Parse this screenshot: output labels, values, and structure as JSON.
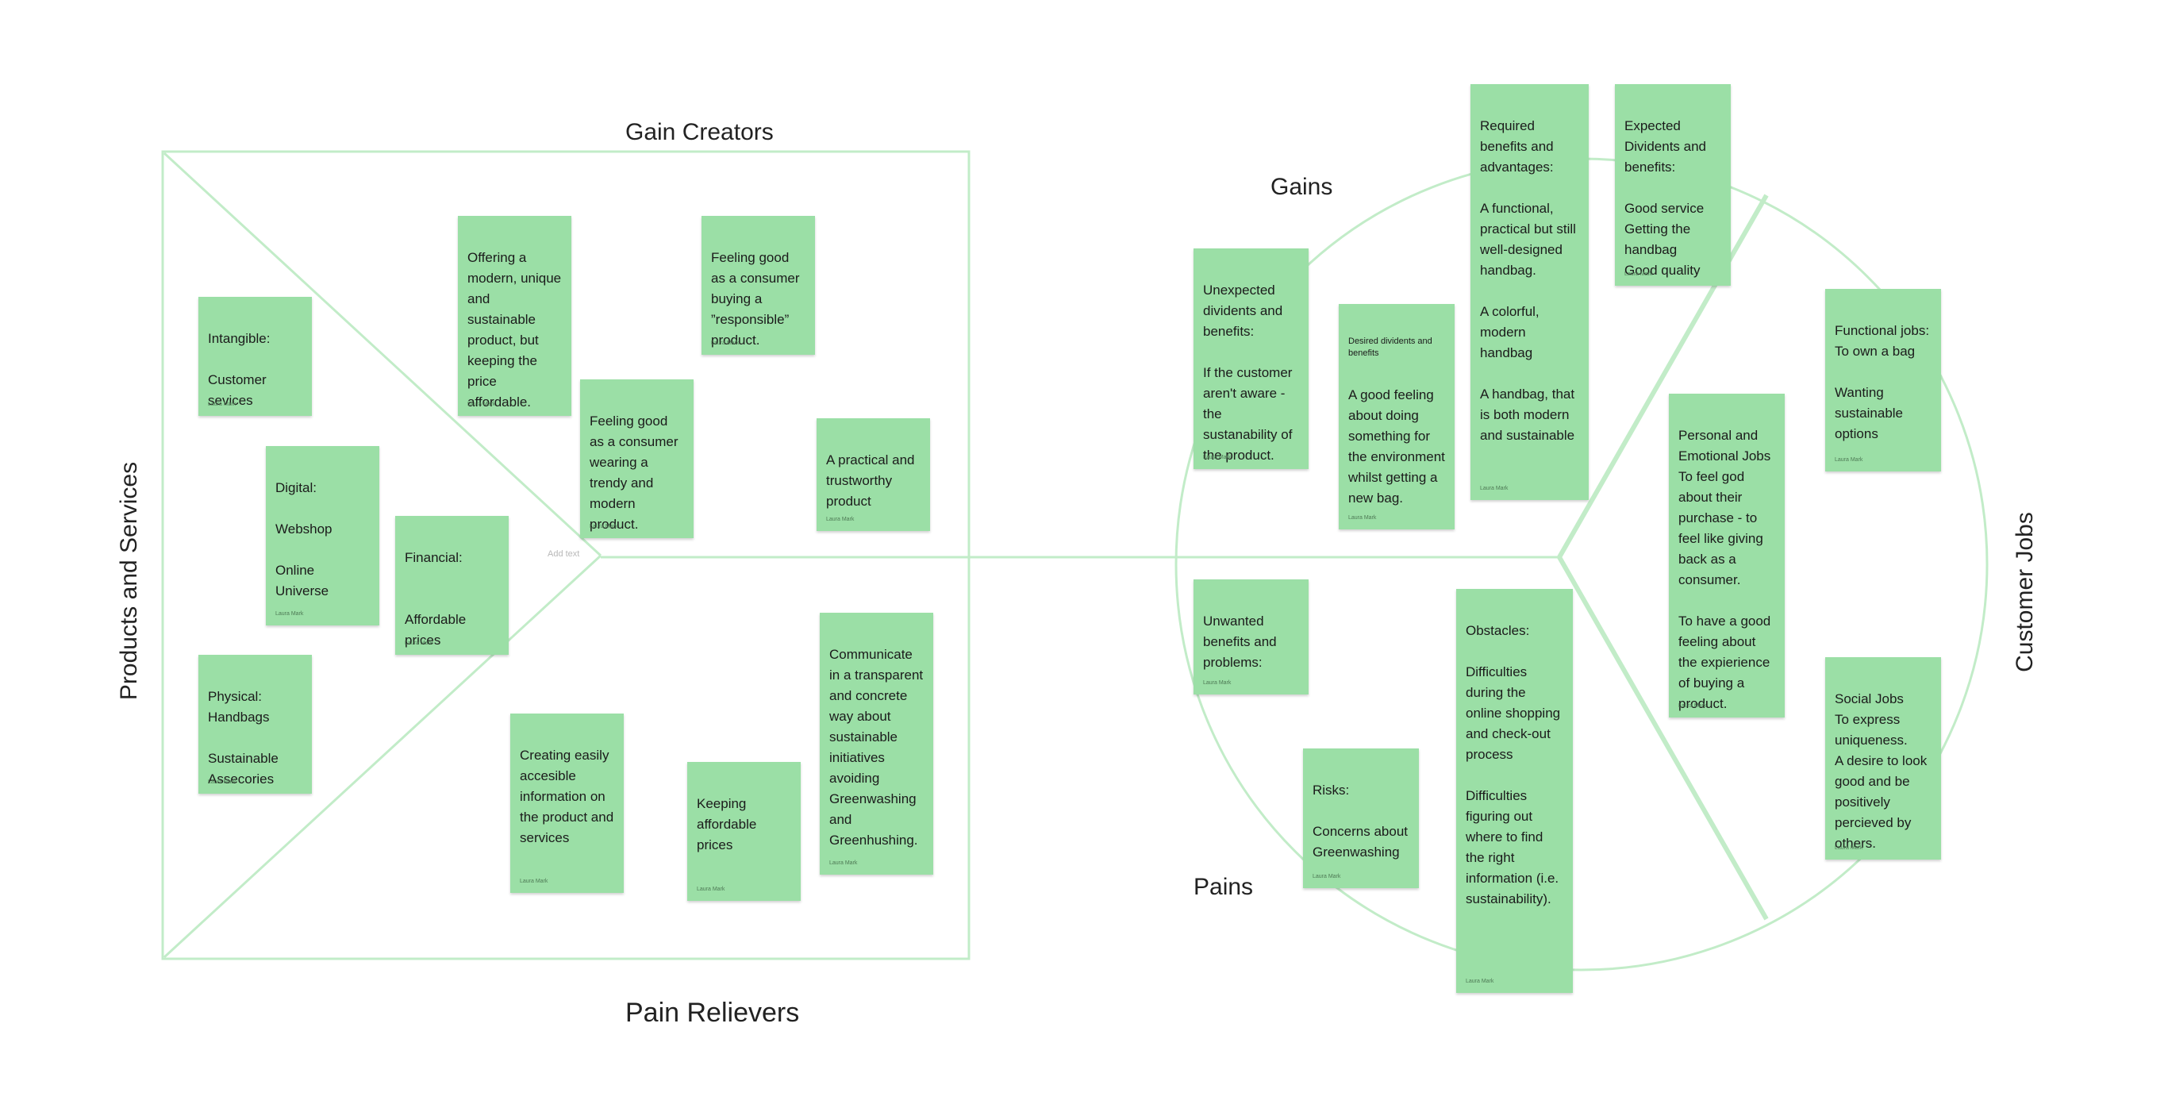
{
  "labels": {
    "gain_creators": "Gain Creators",
    "pain_relievers": "Pain Relievers",
    "products_services": "Products and Services",
    "gains": "Gains",
    "pains": "Pains",
    "customer_jobs": "Customer Jobs",
    "add_text": "Add text"
  },
  "colors": {
    "sticky_note": "#9bdfa6",
    "frame_line": "#c2ecc8"
  },
  "author": "Laura Mark",
  "notes": {
    "intangible": "Intangible:\n\nCustomer sevices",
    "digital": "Digital:\n\nWebshop\n\nOnline Universe",
    "financial": "Financial:\n\n\nAffordable prices",
    "physical": "Physical:\nHandbags\n\nSustainable Assecories",
    "offering": "Offering a modern, unique and sustainable product, but keeping the price affordable.",
    "feeling_wearing": "Feeling good as a consumer wearing a trendy and modern product.",
    "feeling_buying": "Feeling good as a consumer buying a ”responsible” product.",
    "practical": "A practical and trustworthy product",
    "creating_info": "Creating easily accesible information on the product and services",
    "keeping_prices": "Keeping affordable prices",
    "communicate": "Communicate in a transparent and concrete way about sustainable initiatives avoiding Greenwashing and Greenhushing.",
    "unexpected": "Unexpected dividents and benefits:\n\nIf the customer aren't aware - the sustanability of the product.",
    "desired_title": "Desired dividents and benefits",
    "desired_body": "A good feeling about doing something for the environment whilst getting a new bag.",
    "required": "Required benefits and advantages:\n\nA functional, practical but still well-designed handbag.\n\nA colorful, modern handbag\n\nA handbag, that is both modern and sustainable",
    "expected": "Expected Dividents and benefits:\n\nGood service\nGetting the handbag\nGood quality",
    "functional_jobs": "Functional jobs:\nTo own a bag\n\nWanting sustainable options",
    "personal_jobs": "Personal and Emotional Jobs\nTo feel god about their purchase - to feel like giving back as a consumer.\n\nTo have a good feeling about the expierience of buying a product.",
    "social_jobs": "Social Jobs\nTo express uniqueness.\nA desire to look good and be positively percieved by others.",
    "unwanted": "Unwanted benefits and problems:",
    "risks": "Risks:\n\nConcerns about Greenwashing",
    "obstacles": "Obstacles:\n\nDifficulties during the online shopping and check-out process\n\nDifficulties figuring out where to find the right information (i.e. sustainability)."
  }
}
